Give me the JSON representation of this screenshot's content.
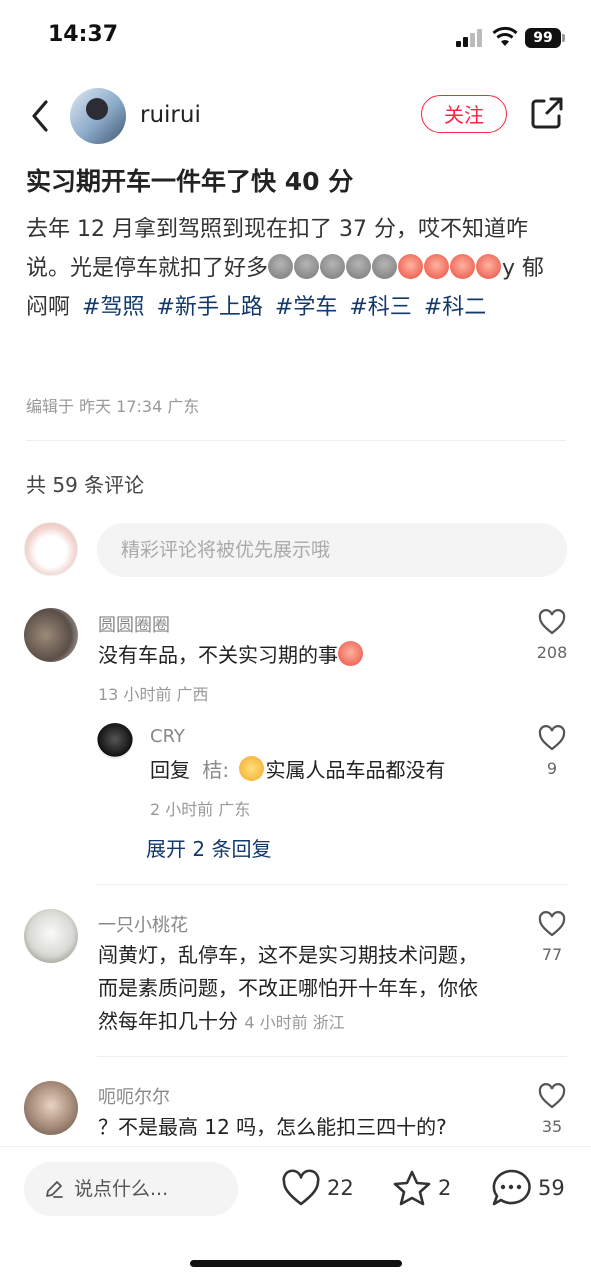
{
  "status_bar": {
    "time": "14:37",
    "battery": "99"
  },
  "header": {
    "username": "ruirui",
    "follow_label": "关注"
  },
  "post": {
    "title": "实习期开车一件年了快 40 分",
    "body_text_1": "去年 12 月拿到驾照到现在扣了 37 分，哎不知道咋说。光是停车就扣了好多",
    "body_text_2": "y 郁闷啊",
    "tags": [
      "#驾照",
      "#新手上路",
      "#学车",
      "#科三",
      "#科二"
    ],
    "meta": "编辑于  昨天 17:34 广东"
  },
  "comments_section": {
    "count_label": "共 59 条评论",
    "input_placeholder": "精彩评论将被优先展示哦"
  },
  "comments": [
    {
      "name": "圆圆圈圈",
      "text": "没有车品，不关实习期的事",
      "meta": "13 小时前  广西",
      "likes": "208"
    },
    {
      "name": "CRY",
      "reply_prefix": "回复",
      "reply_to": "桔",
      "text": "实属人品车品都没有",
      "meta": "2 小时前  广东",
      "likes": "9",
      "expand_label": "展开 2 条回复"
    },
    {
      "name": "一只小桃花",
      "text_1": "闯黄灯，乱停车，这不是实习期技术问题，",
      "text_2": "而是素质问题，不改正哪怕开十年车，你依",
      "text_3": "然每年扣几十分",
      "meta": "4 小时前  浙江",
      "likes": "77"
    },
    {
      "name": "呃呃尔尔",
      "text": "？不是最高 12 吗，怎么能扣三四十的?",
      "likes": "35"
    }
  ],
  "bottom_bar": {
    "say_placeholder": "说点什么...",
    "likes": "22",
    "stars": "2",
    "comments": "59"
  },
  "colors": {
    "accent": "#ff2442",
    "tag": "#13386c"
  }
}
